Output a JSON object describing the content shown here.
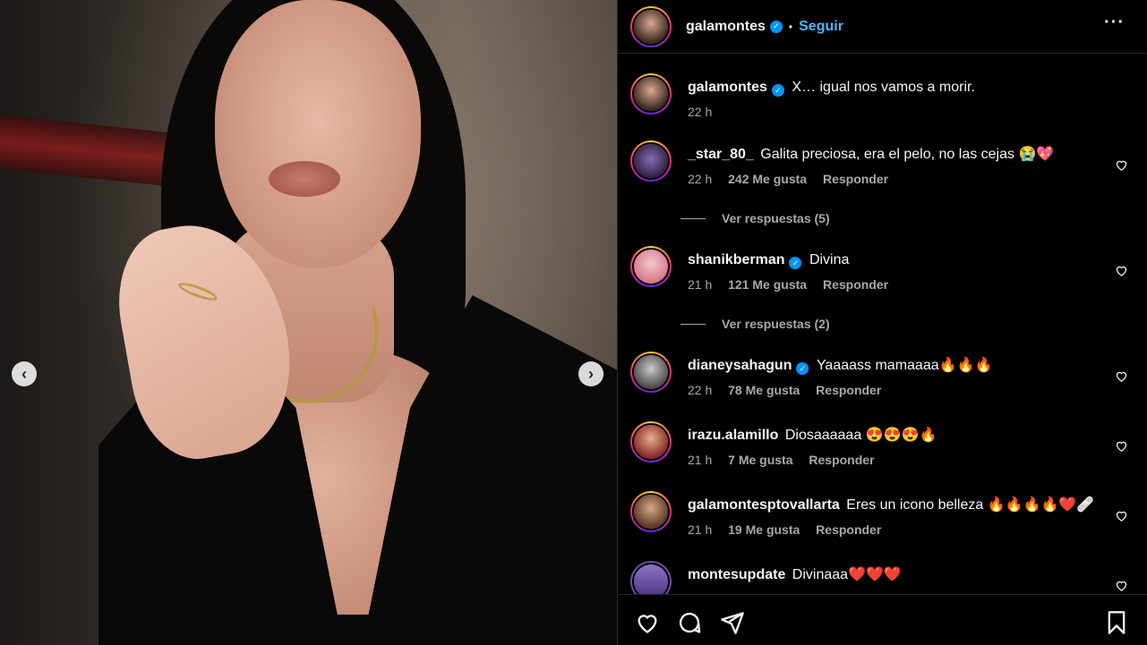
{
  "post": {
    "author": "galamontes",
    "follow_label": "Seguir",
    "caption": "X… igual nos vamos a morir.",
    "caption_time": "22 h",
    "accent_color": "#0095f6",
    "follow_color": "#4db5f9"
  },
  "carousel": {
    "prev_icon": "‹",
    "next_icon": "›"
  },
  "comments": [
    {
      "user": "_star_80_",
      "verified": false,
      "text": "Galita preciosa, era el pelo, no las cejas 😭💖",
      "time": "22 h",
      "likes": "242 Me gusta",
      "reply": "Responder",
      "view_replies": "Ver respuestas (5)"
    },
    {
      "user": "shanikberman",
      "verified": true,
      "text": "Divina",
      "time": "21 h",
      "likes": "121 Me gusta",
      "reply": "Responder",
      "view_replies": "Ver respuestas (2)"
    },
    {
      "user": "dianeysahagun",
      "verified": true,
      "text": "Yaaaass mamaaaa🔥🔥🔥",
      "time": "22 h",
      "likes": "78 Me gusta",
      "reply": "Responder"
    },
    {
      "user": "irazu.alamillo",
      "verified": false,
      "text": "Diosaaaaaa 😍😍😍🔥",
      "time": "21 h",
      "likes": "7 Me gusta",
      "reply": "Responder"
    },
    {
      "user": "galamontesptovallarta",
      "verified": false,
      "text": "Eres un icono belleza 🔥🔥🔥🔥❤️🩹",
      "time": "21 h",
      "likes": "19 Me gusta",
      "reply": "Responder"
    },
    {
      "user": "montesupdate",
      "verified": false,
      "text": "Divinaaa❤️❤️❤️"
    }
  ],
  "icons": {
    "more": "more-options-icon",
    "heart": "heart-icon",
    "comment": "comment-icon",
    "share": "share-icon",
    "save": "bookmark-icon"
  }
}
